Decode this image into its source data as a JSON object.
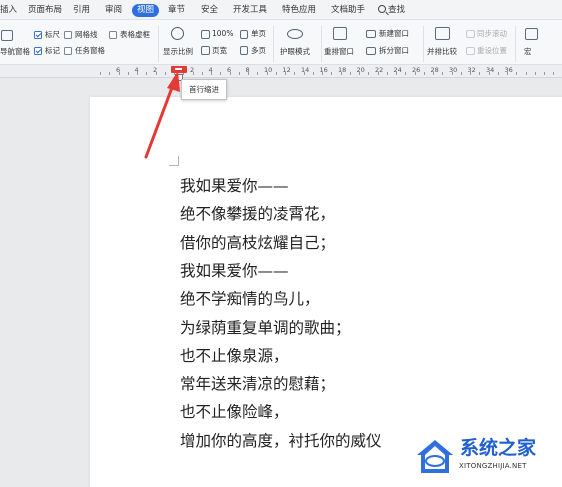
{
  "tabs": [
    "插入",
    "页面布局",
    "引用",
    "审阅",
    "视图",
    "章节",
    "安全",
    "开发工具",
    "特色应用",
    "文档助手",
    "查找"
  ],
  "active_tab": "视图",
  "ribbon": {
    "nav_pane_label": "导航窗格",
    "ruler_label": "标尺",
    "gridlines_label": "网格线",
    "table_border_label": "表格虚框",
    "marks_label": "标记",
    "task_pane_label": "任务窗格",
    "zoom_label": "显示比例",
    "zoom_100_label": "100%",
    "page_width_label": "页宽",
    "single_page_label": "单页",
    "multi_page_label": "多页",
    "eye_mode_label": "护眼模式",
    "rearrange_label": "重排窗口",
    "new_window_label": "新建窗口",
    "split_window_label": "拆分窗口",
    "side_by_side_label": "并排比较",
    "sync_scroll_label": "同步滚动",
    "reset_position_label": "重设位置",
    "macro_label": "宏"
  },
  "ruler": {
    "numbers": [
      "6",
      "4",
      "2",
      "2",
      "4",
      "6",
      "8",
      "10",
      "12",
      "14",
      "16",
      "18",
      "20",
      "22",
      "24",
      "26",
      "28",
      "30",
      "32",
      "34",
      "36"
    ]
  },
  "tooltip": "首行缩进",
  "document": {
    "lines": [
      "我如果爱你——",
      "绝不像攀援的凌霄花，",
      "借你的高枝炫耀自己；",
      "我如果爱你——",
      "绝不学痴情的鸟儿，",
      "为绿荫重复单调的歌曲；",
      "也不止像泉源，",
      "常年送来清凉的慰藉；",
      "也不止像险峰，",
      "增加你的高度，衬托你的威仪"
    ]
  },
  "watermark": {
    "title": "系统之家",
    "url": "XITONGZHIJIA.NET"
  },
  "colors": {
    "accent": "#2e6fe0",
    "arrow": "#e53935",
    "watermark": "#1f5fcf"
  }
}
